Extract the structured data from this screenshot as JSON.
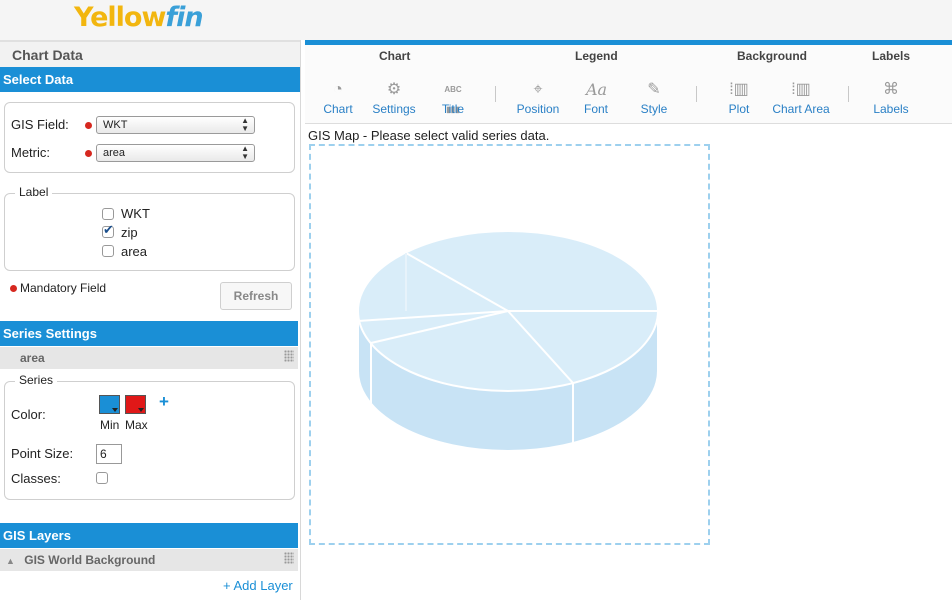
{
  "app": {
    "logo_part1": "Y",
    "logo_part2": "ellow",
    "logo_part3": "fin"
  },
  "left_panel": {
    "title": "Chart Data",
    "select_data": {
      "heading": "Select Data",
      "gis_field_label": "GIS Field:",
      "gis_field_value": "WKT",
      "metric_label": "Metric:",
      "metric_value": "area"
    },
    "label_box": {
      "legend": "Label",
      "options": [
        {
          "label": "WKT",
          "checked": false
        },
        {
          "label": "zip",
          "checked": true
        },
        {
          "label": "area",
          "checked": false
        }
      ]
    },
    "mandatory_text": "Mandatory Field",
    "refresh_label": "Refresh",
    "series_settings": {
      "heading": "Series Settings",
      "series_row": "area",
      "legend": "Series",
      "color_label": "Color:",
      "min_label": "Min",
      "max_label": "Max",
      "min_color": "#1a8fd6",
      "max_color": "#e01818",
      "plus": "+",
      "point_size_label": "Point Size:",
      "point_size_value": "6",
      "classes_label": "Classes:"
    },
    "gis_layers": {
      "heading": "GIS Layers",
      "layer_name": "GIS World Background",
      "add_layer_label": "+ Add Layer"
    }
  },
  "toolbar": {
    "groups": [
      "Chart",
      "Legend",
      "Background",
      "Labels"
    ],
    "tools": {
      "chart": "Chart",
      "settings": "Settings",
      "title": "Title",
      "position": "Position",
      "font": "Font",
      "style": "Style",
      "plot": "Plot",
      "chart_area": "Chart Area",
      "labels": "Labels"
    }
  },
  "main": {
    "message": "GIS Map - Please select valid series data."
  },
  "colors": {
    "accent": "#1a8fd6",
    "required": "#d6281f",
    "pie_fill": "#cfe8f7"
  }
}
